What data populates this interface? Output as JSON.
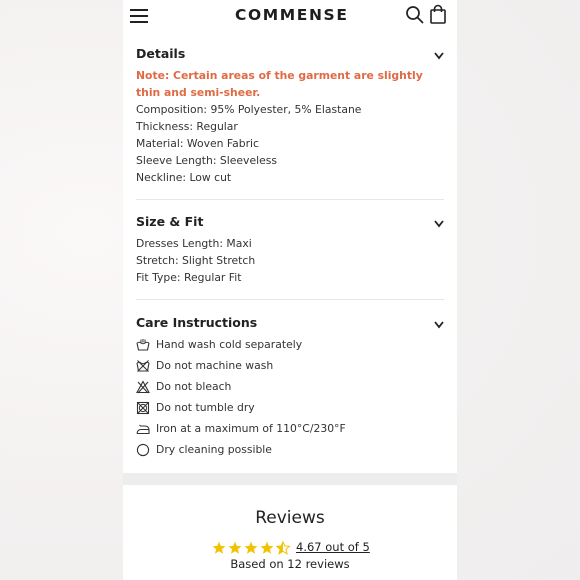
{
  "header": {
    "logo": "COMMENSE",
    "menu_icon": "hamburger-menu-icon",
    "search_icon": "search-icon",
    "bag_icon": "shopping-bag-icon"
  },
  "details": {
    "title": "Details",
    "note": "Note: Certain areas of the garment are slightly thin and semi-sheer.",
    "note_color": "#e06a43",
    "lines": [
      "Composition: 95% Polyester, 5% Elastane",
      "Thickness: Regular",
      "Material: Woven Fabric",
      "Sleeve Length: Sleeveless",
      "Neckline: Low cut"
    ]
  },
  "size_fit": {
    "title": "Size & Fit",
    "lines": [
      "Dresses Length: Maxi",
      "Stretch: Slight Stretch",
      "Fit Type: Regular Fit"
    ]
  },
  "care": {
    "title": "Care Instructions",
    "items": [
      {
        "icon": "hand-wash-icon",
        "label": "Hand wash cold separately"
      },
      {
        "icon": "no-machine-wash-icon",
        "label": "Do not machine wash"
      },
      {
        "icon": "no-bleach-icon",
        "label": "Do not bleach"
      },
      {
        "icon": "no-tumble-dry-icon",
        "label": "Do not tumble dry"
      },
      {
        "icon": "iron-icon",
        "label": "Iron at a maximum of 110°C/230°F"
      },
      {
        "icon": "dry-clean-icon",
        "label": "Dry cleaning possible"
      }
    ]
  },
  "reviews": {
    "title": "Reviews",
    "rating": 4.67,
    "rating_text": "4.67 out of 5",
    "based_on": "Based on 12 reviews",
    "star_color": "#f2c200"
  }
}
